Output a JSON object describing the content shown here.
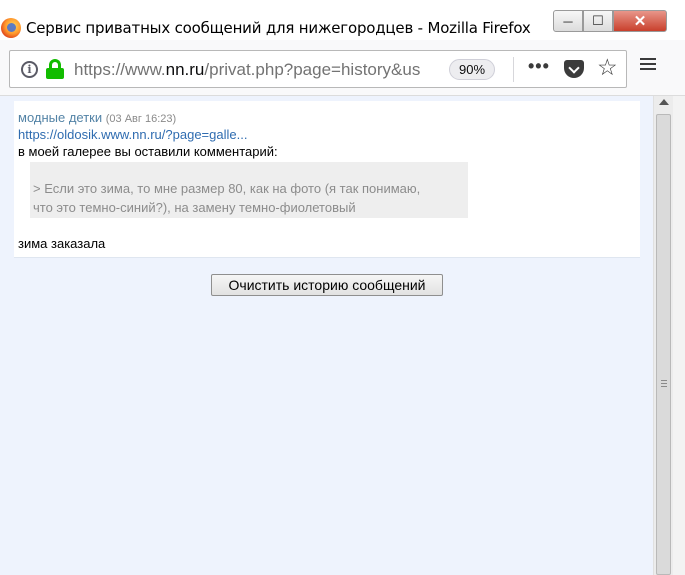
{
  "window": {
    "title": "Сервис приватных сообщений для нижегородцев - Mozilla Firefox",
    "minimize_glyph": "─",
    "maximize_glyph": "☐",
    "close_glyph": "✕"
  },
  "toolbar": {
    "url_prefix": "https://www.",
    "url_host": "nn.ru",
    "url_rest": "/privat.php?page=history&us",
    "zoom": "90%",
    "more_glyph": "•••",
    "star_glyph": "☆",
    "info_glyph": "i"
  },
  "message": {
    "sender": "модные детки",
    "date": "(03 Авг 16:23)",
    "link": "https://oldosik.www.nn.ru/?page=galle...",
    "intro": "в моей галерее вы оставили комментарий:",
    "quote_lines": [
      "> Если это зима, то мне размер 80, как на фото (я так понимаю,",
      "что это темно-синий?), на замену темно-фиолетовый"
    ],
    "reply": "зима заказала"
  },
  "actions": {
    "clear_history": "Очистить историю сообщений"
  },
  "colors": {
    "sender": "#5383a6",
    "link": "#2f6cb0",
    "lock": "#12bc00",
    "page_bg": "#eef3fd"
  },
  "icons": [
    "firefox-logo-icon",
    "info-icon",
    "lock-icon",
    "more-icon",
    "pocket-icon",
    "bookmark-star-icon",
    "hamburger-menu-icon",
    "scroll-up-arrow-icon"
  ]
}
